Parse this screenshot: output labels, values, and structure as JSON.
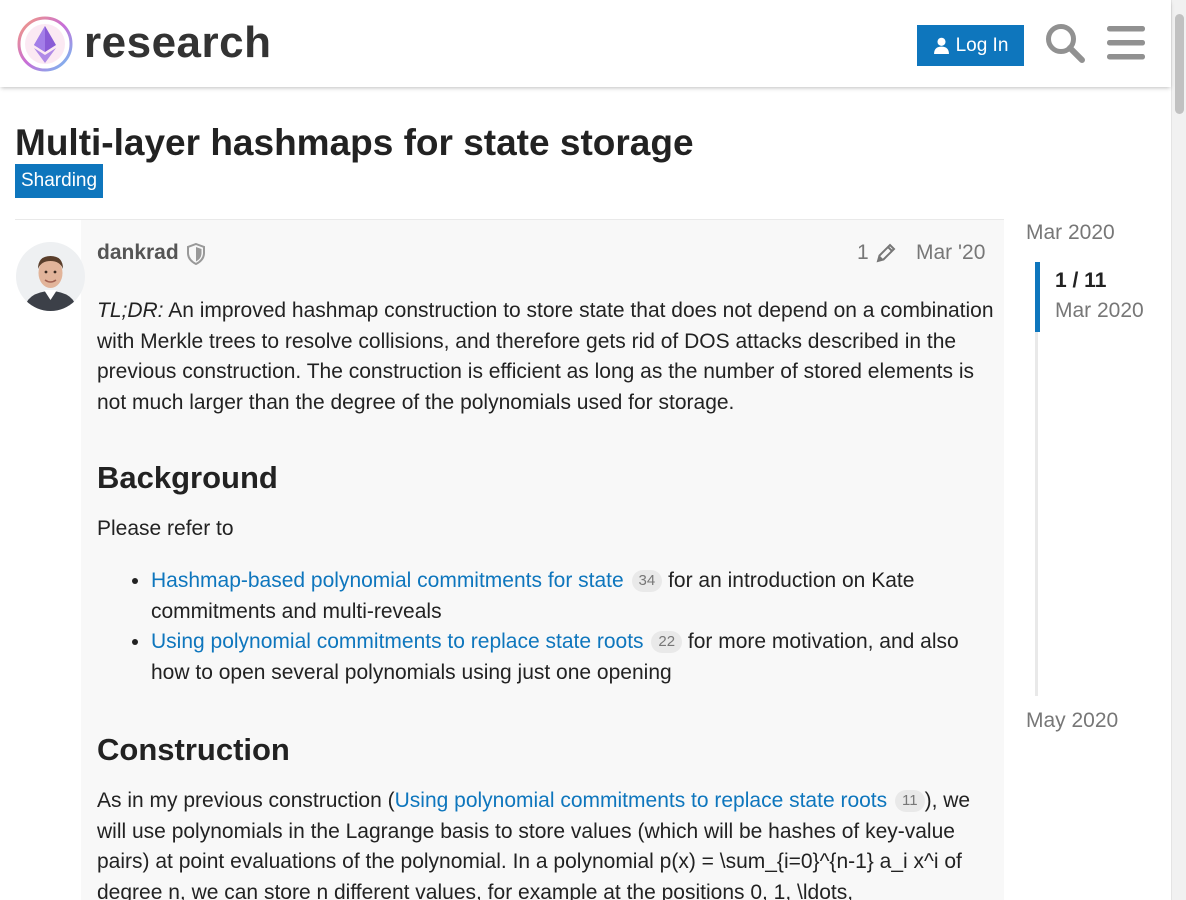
{
  "header": {
    "site_name": "research",
    "login_label": "Log In",
    "icons": {
      "search": "search-icon",
      "menu": "hamburger-icon",
      "user": "user-icon"
    },
    "accent_color": "#0e76bd"
  },
  "topic": {
    "title": "Multi-layer hashmaps for state storage",
    "category": "Sharding"
  },
  "post": {
    "author": "dankrad",
    "edit_count": "1",
    "date": "Mar '20",
    "tldr_label": "TL;DR:",
    "tldr_text": " An improved hashmap construction to store state that does not depend on a combination with Merkle trees to resolve collisions, and therefore gets rid of DOS attacks described in the previous construction. The construction is efficient as long as the number of stored elements is not much larger than the degree of the polynomials used for storage.",
    "background_heading": "Background",
    "refer_text": "Please refer to",
    "references": [
      {
        "link": "Hashmap-based polynomial commitments for state",
        "count": "34",
        "text": " for an introduction on Kate commitments and multi-reveals"
      },
      {
        "link": "Using polynomial commitments to replace state roots",
        "count": "22",
        "text": " for more motivation, and also how to open several polynomials using just one opening"
      }
    ],
    "construction_heading": "Construction",
    "construction": {
      "before": "As in my previous construction (",
      "link": "Using polynomial commitments to replace state roots",
      "count": "11",
      "after": "), we will use polynomials in the Lagrange basis to store values (which will be hashes of key-value pairs) at point evaluations of the polynomial. In a polynomial p(x) = \\sum_{i=0}^{n-1} a_i x^i of degree n, we can store n different values, for example at the positions 0, 1, \\ldots,"
    }
  },
  "timeline": {
    "start": "Mar 2020",
    "position": "1 / 11",
    "position_date": "Mar 2020",
    "end": "May 2020",
    "progress": 0.09
  }
}
